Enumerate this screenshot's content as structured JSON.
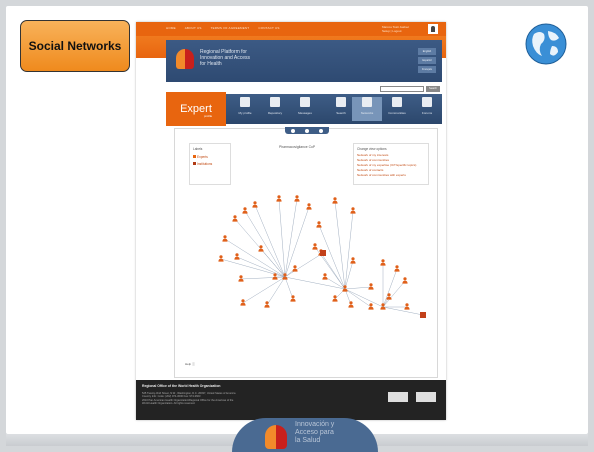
{
  "slide": {
    "title": "Social Networks",
    "bottom_logo_text": [
      "Innovación y",
      "Acceso para",
      "la Salud"
    ]
  },
  "website": {
    "top_nav": [
      "HOME",
      "ABOUT US",
      "TERMS OF AGREEMENT",
      "CONTACT US"
    ],
    "user_name": "Marcos Tosti Jasbec",
    "user_links": "Setup  |  Logout",
    "platform_name": [
      "Regional Platform for",
      "Innovation and Access",
      "for Health"
    ],
    "side_buttons": [
      "English",
      "Español",
      "Français"
    ],
    "search_button": "Search",
    "expert_label": "Expert",
    "expert_sub": "profile",
    "menu": [
      {
        "label": "My profile",
        "icon": "id-card-icon"
      },
      {
        "label": "Repository",
        "icon": "books-icon"
      },
      {
        "label": "Messages",
        "icon": "mail-icon"
      },
      {
        "label": "Search",
        "icon": "search-doc-icon"
      },
      {
        "label": "Networks",
        "icon": "network-icon"
      },
      {
        "label": "Communities",
        "icon": "community-icon"
      },
      {
        "label": "Forums",
        "icon": "chat-icon"
      }
    ],
    "active_menu": "Networks",
    "labels_title": "Labels",
    "labels": [
      "Experts",
      "Institutions"
    ],
    "graph_title": "Pharmacovigilance CoP",
    "view_options_title": "Change view options",
    "view_options": [
      "Network of my interests",
      "Network of communities",
      "Network of my expertise (ICT/specific topics)",
      "Network of contacts",
      "Network of communities with experts"
    ],
    "help_text": "Help",
    "footer_title": "Regional Office of the World Health Organization",
    "footer_text": [
      "525 Twenty-third Street, N.W., Washington, D.C. 20037, United States of America",
      "Country Info: Code: (202) 974-3000 Fax: 974-3663",
      "2010 Pan American Health Organization/Regional Office for the Americas of the",
      "World Health Organization. All rights reserved."
    ]
  },
  "colors": {
    "orange": "#e8650f",
    "navy": "#2e4a72",
    "node": "#e0601a",
    "institution": "#c2401a"
  }
}
